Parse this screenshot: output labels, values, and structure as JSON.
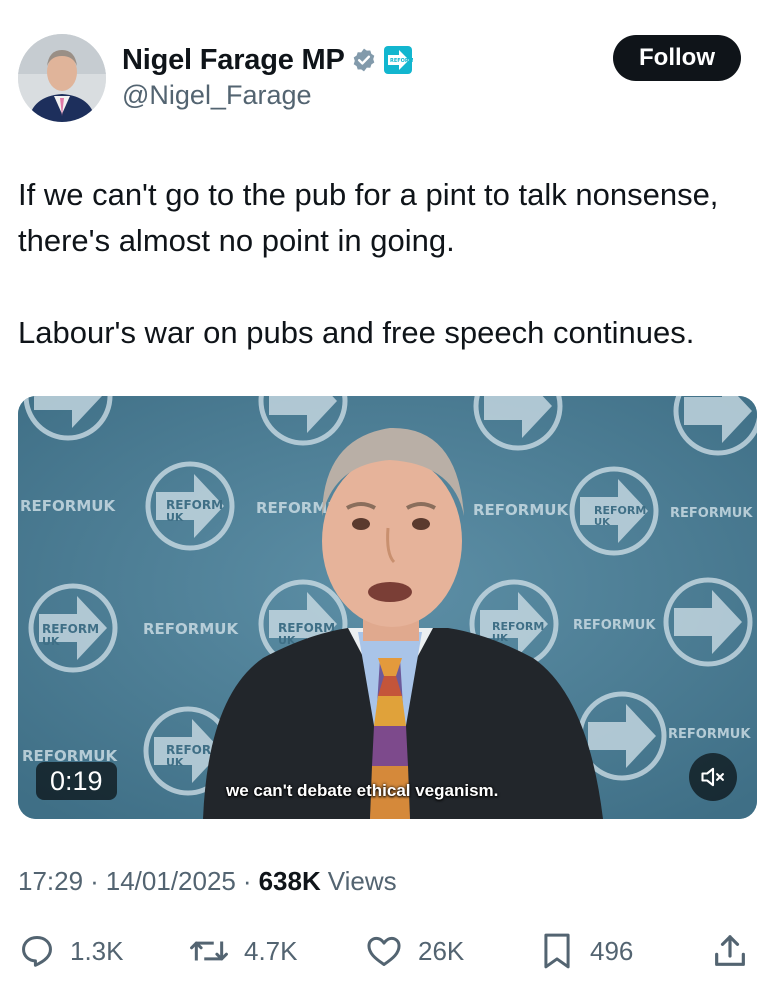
{
  "author": {
    "name": "Nigel Farage MP",
    "handle": "@Nigel_Farage",
    "follow_label": "Follow",
    "verified_icon": "verified-badge-icon",
    "affiliation_badge_text": "REFORM UK"
  },
  "tweet": {
    "paragraphs": [
      "If we can't go to the pub for a pint to talk nonsense, there's almost no point in going.",
      "Labour's war on pubs and free speech continues."
    ]
  },
  "video": {
    "duration": "0:19",
    "subtitle": "we can't debate ethical veganism.",
    "backdrop_text": "REFORMUK",
    "backdrop_logo_text": "REFORM",
    "backdrop_logo_sub": "UK",
    "mute_icon": "speaker-muted-icon"
  },
  "meta": {
    "time": "17:29",
    "date": "14/01/2025",
    "views_count": "638K",
    "views_label": "Views"
  },
  "actions": {
    "replies": "1.3K",
    "reposts": "4.7K",
    "likes": "26K",
    "bookmarks": "496"
  },
  "colors": {
    "text_primary": "#0f1419",
    "text_secondary": "#536471",
    "follow_bg": "#0f1419",
    "verified": "#829aab",
    "reform_teal": "#12b6cf",
    "video_bg": "#4f8096"
  }
}
